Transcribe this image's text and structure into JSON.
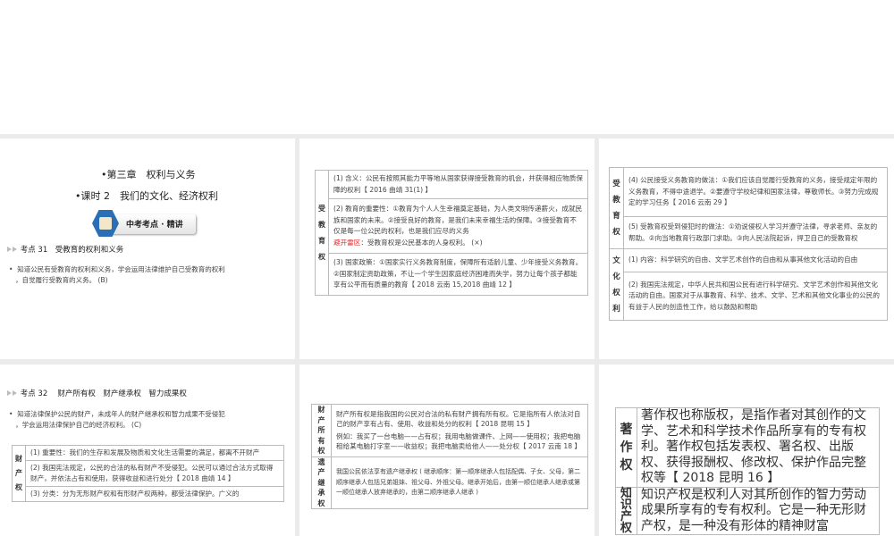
{
  "slide1": {
    "chapter": "•第三章　权利与义务",
    "lesson": "•课时 2　我们的文化、经济权利",
    "badge": "中考考点 · 精讲",
    "point": "考点 31　受教育的权利和义务",
    "req_line1": "知道公民有受教育的权利和义务，学会运用法律维护自己受教育的权利",
    "req_line2": "，自觉履行受教育的义务。 (B)"
  },
  "slide2": {
    "label": "受教育权",
    "rows": [
      "(1) 含义：公民有按照其能力平等地从国家获得接受教育的机会，并获得相应物质保障的权利【 2016 曲靖 31(1) 】",
      "(2) 教育的重要性：①教育为个人人生幸福奠定基础，为人类文明传递薪火，成就民族和国家的未来。②接受良好的教育，是我们未来幸福生活的保障。③接受教育不仅是每一位公民的权利，也是我们应尽的义务",
      "(3) 国家政策：①国家实行义务教育制度，保障所有适龄儿童、少年接受义务教育。②国家制定资助政策，不让一个学生因家庭经济困难而失学，努力让每个孩子都能享有公平而有质量的教育【 2018 云南 15,2018 曲靖 12 】"
    ],
    "warn_label": "避开雷区",
    "warn_text": "：受教育权是公民基本的人身权利。 (×)"
  },
  "slide3": {
    "label1": "受教育权",
    "label2": "文化权利",
    "rows": [
      "(4) 公民接受义务教育的做法：①我们应该自觉履行受教育的义务，接受规定年限的义务教育，不得中途退学。②要遵守学校纪律和国家法律，尊敬师长。③努力完成规定的学习任务【 2016 云南 29 】",
      "(5) 受教育权受到侵犯时的做法：①劝说侵权人学习并遵守法律，寻求老师、亲友的帮助。②向当地教育行政部门求助。③向人民法院起诉，捍卫自己的受教育权",
      "(1) 内容：科学研究的自由、文学艺术创作的自由和从事其他文化活动的自由",
      "(2) 我国宪法规定，中华人民共和国公民有进行科学研究、文学艺术创作和其他文化活动的自由。国家对于从事教育、科学、技术、文学、艺术和其他文化事业的公民的有益于人民的创造性工作，给以鼓励和帮助"
    ]
  },
  "slide4": {
    "point": "考点 32　 财产所有权　财产继承权　智力成果权",
    "req_line1": "知道法律保护公民的财产，未成年人的财产继承权和智力成果不受侵犯",
    "req_line2": "，学会运用法律保护自己的经济权利。 (C)",
    "label": "财产权",
    "rows": [
      "(1) 重要性：我们的生存和发展及物质和文化生活需要的满足，都离不开财产",
      "(2) 我国宪法规定，公民的合法的私有财产不受侵犯。公民可以通过合法方式取得财产，并依法占有和使用，获得收益和进行处分【 2018 曲靖 14 】",
      "(3) 分类：分为无形财产权和有形财产权两种，都受法律保护。广义的"
    ]
  },
  "slide5": {
    "label1": "财产所有权",
    "label2": "遗产继承权",
    "row1a": "财产所有权是指我国的公民对合法的私有财产拥有所有权。它是指所有人依法对自己的财产享有占有、使用、收益和处分的权利【 2018 昆明 15 】",
    "row1b": "例如：我买了一台电脑——占有权；我用电脑做课件、上网——使用权；我把电脑租给某电脑打字室——收益权；我把电脑卖给他人——处分权【 2017 云南 18 】",
    "row2": "我国公民依法享有遗产继承权 ( 继承顺序：第一顺序继承人包括配偶、子女、父母，第二顺序继承人包括兄弟姐妹、祖父母、外祖父母。继承开始后，由第一顺位继承人继承或第一顺位继承人放弃继承的，由第二顺序继承人继承 )"
  },
  "slide6": {
    "label1": "著作权",
    "label2": "知识产权",
    "row1": "著作权也称版权，是指作者对其创作的文学、艺术和科学技术作品所享有的专有权利。著作权包括发表权、署名权、出版权、获得报酬权、修改权、保护作品完整权等【 2018 昆明 16 】",
    "row2": "知识产权是权利人对其所创作的智力劳动成果所享有的专有权利。它是一种无形财产权，是一种没有形体的精神财富"
  }
}
